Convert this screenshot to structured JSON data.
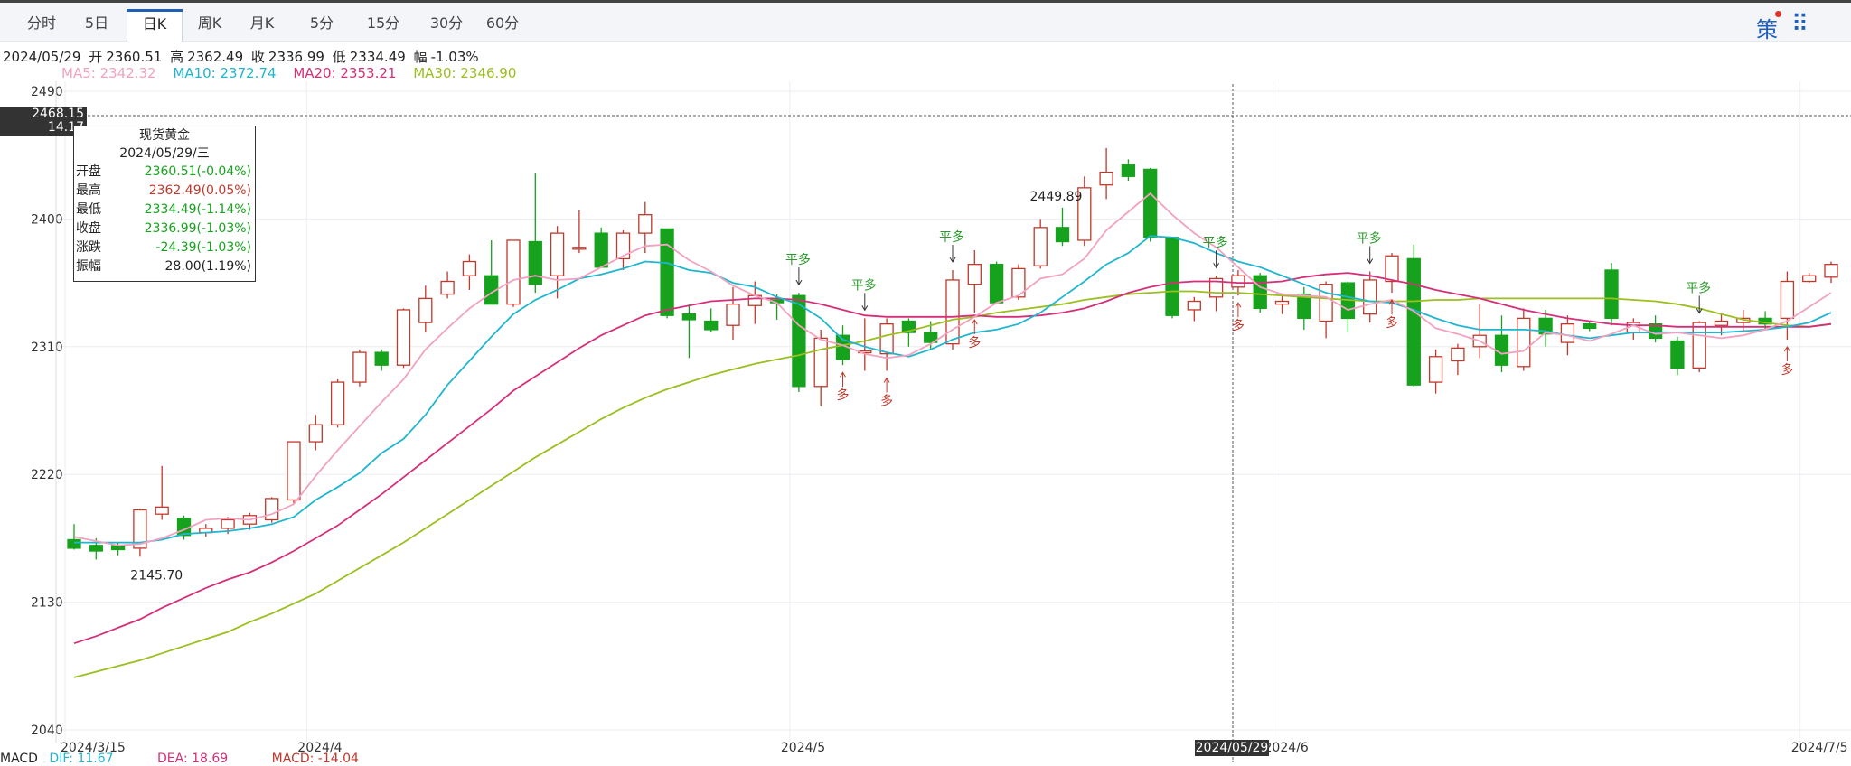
{
  "tabs": [
    {
      "label": "分时",
      "active": false
    },
    {
      "label": "5日",
      "active": false
    },
    {
      "label": "日K",
      "active": true
    },
    {
      "label": "周K",
      "active": false
    },
    {
      "label": "月K",
      "active": false
    },
    {
      "label": "5分",
      "active": false
    },
    {
      "label": "15分",
      "active": false
    },
    {
      "label": "30分",
      "active": false
    },
    {
      "label": "60分",
      "active": false
    }
  ],
  "toolbar": {
    "strategy_icon": "策",
    "layout_icon": "⠿"
  },
  "quote_line": {
    "date": "2024/05/29",
    "open_label": "开",
    "open": "2360.51",
    "high_label": "高",
    "high": "2362.49",
    "close_label": "收",
    "close": "2336.99",
    "low_label": "低",
    "low": "2334.49",
    "range_label": "幅",
    "range": "-1.03%"
  },
  "ma_line": {
    "ma5": "MA5: 2342.32",
    "ma10": "MA10: 2372.74",
    "ma20": "MA20: 2353.21",
    "ma30": "MA30: 2346.90"
  },
  "colors": {
    "up": "#c0392b",
    "down": "#16a21d",
    "ma5": "#f2a2c0",
    "ma10": "#1fb6cf",
    "ma20": "#d62f79",
    "ma30": "#9abf1e",
    "marker_down": "#2a9a2a",
    "marker_up": "#c0392b"
  },
  "tooltip": {
    "title": "现货黄金",
    "date": "2024/05/29/三",
    "rows": [
      {
        "k": "开盘",
        "v": "2360.51(-0.04%)",
        "c": "#16a21d"
      },
      {
        "k": "最高",
        "v": "2362.49(0.05%)",
        "c": "#c0392b"
      },
      {
        "k": "最低",
        "v": "2334.49(-1.14%)",
        "c": "#16a21d"
      },
      {
        "k": "收盘",
        "v": "2336.99(-1.03%)",
        "c": "#16a21d"
      },
      {
        "k": "涨跌",
        "v": "-24.39(-1.03%)",
        "c": "#16a21d"
      },
      {
        "k": "振幅",
        "v": "28.00(1.19%)",
        "c": "#222222"
      }
    ]
  },
  "crosshair": {
    "price": "2468.15",
    "sub": "14.17",
    "date": "2024/05/29"
  },
  "macd_line": {
    "dif": "DIF: 11.67",
    "dea": "DEA: 18.69",
    "macd": "MACD: -14.04",
    "label": "MACD"
  },
  "chart_data": {
    "type": "candlestick",
    "y_ticks": [
      2040,
      2130,
      2220,
      2310,
      2400,
      2490
    ],
    "ylim": [
      2040,
      2490
    ],
    "x_labels": [
      {
        "text": "2024/3/15",
        "index": 0
      },
      {
        "text": "2024/4",
        "index": 11
      },
      {
        "text": "2024/5",
        "index": 33
      },
      {
        "text": "2024/6",
        "index": 55
      },
      {
        "text": "2024/7/5",
        "index": 79
      }
    ],
    "max_label": {
      "text": "2449.89",
      "index": 45
    },
    "min_label": {
      "text": "2145.70",
      "index": 1
    },
    "candles": [
      {
        "o": 2174,
        "h": 2185,
        "l": 2167,
        "c": 2168
      },
      {
        "o": 2170,
        "h": 2175,
        "l": 2160,
        "c": 2166
      },
      {
        "o": 2170,
        "h": 2172,
        "l": 2163,
        "c": 2167
      },
      {
        "o": 2168,
        "h": 2196,
        "l": 2162,
        "c": 2195
      },
      {
        "o": 2192,
        "h": 2226,
        "l": 2188,
        "c": 2197
      },
      {
        "o": 2189,
        "h": 2191,
        "l": 2174,
        "c": 2177
      },
      {
        "o": 2179,
        "h": 2185,
        "l": 2176,
        "c": 2182
      },
      {
        "o": 2182,
        "h": 2190,
        "l": 2178,
        "c": 2188
      },
      {
        "o": 2185,
        "h": 2193,
        "l": 2181,
        "c": 2191
      },
      {
        "o": 2188,
        "h": 2204,
        "l": 2186,
        "c": 2203
      },
      {
        "o": 2202,
        "h": 2243,
        "l": 2199,
        "c": 2243
      },
      {
        "o": 2243,
        "h": 2262,
        "l": 2237,
        "c": 2255
      },
      {
        "o": 2255,
        "h": 2287,
        "l": 2253,
        "c": 2285
      },
      {
        "o": 2285,
        "h": 2308,
        "l": 2282,
        "c": 2306
      },
      {
        "o": 2306,
        "h": 2308,
        "l": 2293,
        "c": 2297
      },
      {
        "o": 2297,
        "h": 2337,
        "l": 2295,
        "c": 2336
      },
      {
        "o": 2327,
        "h": 2353,
        "l": 2320,
        "c": 2344
      },
      {
        "o": 2347,
        "h": 2363,
        "l": 2344,
        "c": 2356
      },
      {
        "o": 2360,
        "h": 2375,
        "l": 2350,
        "c": 2370
      },
      {
        "o": 2360,
        "h": 2385,
        "l": 2342,
        "c": 2340
      },
      {
        "o": 2340,
        "h": 2385,
        "l": 2338,
        "c": 2385
      },
      {
        "o": 2384,
        "h": 2432,
        "l": 2348,
        "c": 2354
      },
      {
        "o": 2360,
        "h": 2395,
        "l": 2344,
        "c": 2390
      },
      {
        "o": 2380,
        "h": 2406,
        "l": 2376,
        "c": 2380
      },
      {
        "o": 2390,
        "h": 2394,
        "l": 2366,
        "c": 2366
      },
      {
        "o": 2372,
        "h": 2392,
        "l": 2364,
        "c": 2390
      },
      {
        "o": 2390,
        "h": 2412,
        "l": 2376,
        "c": 2403
      },
      {
        "o": 2393,
        "h": 2393,
        "l": 2330,
        "c": 2332
      },
      {
        "o": 2333,
        "h": 2340,
        "l": 2302,
        "c": 2329
      },
      {
        "o": 2328,
        "h": 2337,
        "l": 2320,
        "c": 2322
      },
      {
        "o": 2325,
        "h": 2352,
        "l": 2315,
        "c": 2340
      },
      {
        "o": 2339,
        "h": 2356,
        "l": 2326,
        "c": 2346
      },
      {
        "o": 2343,
        "h": 2347,
        "l": 2329,
        "c": 2341
      },
      {
        "o": 2346,
        "h": 2348,
        "l": 2278,
        "c": 2282
      },
      {
        "o": 2282,
        "h": 2322,
        "l": 2268,
        "c": 2316
      },
      {
        "o": 2318,
        "h": 2325,
        "l": 2297,
        "c": 2301
      },
      {
        "o": 2307,
        "h": 2330,
        "l": 2293,
        "c": 2307
      },
      {
        "o": 2305,
        "h": 2330,
        "l": 2293,
        "c": 2326
      },
      {
        "o": 2328,
        "h": 2330,
        "l": 2310,
        "c": 2320
      },
      {
        "o": 2320,
        "h": 2328,
        "l": 2308,
        "c": 2313
      },
      {
        "o": 2312,
        "h": 2364,
        "l": 2308,
        "c": 2357
      },
      {
        "o": 2354,
        "h": 2378,
        "l": 2334,
        "c": 2368
      },
      {
        "o": 2368,
        "h": 2370,
        "l": 2340,
        "c": 2341
      },
      {
        "o": 2345,
        "h": 2368,
        "l": 2343,
        "c": 2365
      },
      {
        "o": 2367,
        "h": 2400,
        "l": 2365,
        "c": 2394
      },
      {
        "o": 2394,
        "h": 2408,
        "l": 2381,
        "c": 2384
      },
      {
        "o": 2385,
        "h": 2430,
        "l": 2381,
        "c": 2422
      },
      {
        "o": 2424,
        "h": 2450,
        "l": 2414,
        "c": 2433
      },
      {
        "o": 2438,
        "h": 2442,
        "l": 2427,
        "c": 2430
      },
      {
        "o": 2435,
        "h": 2436,
        "l": 2384,
        "c": 2387
      },
      {
        "o": 2387,
        "h": 2386,
        "l": 2330,
        "c": 2332
      },
      {
        "o": 2336,
        "h": 2345,
        "l": 2328,
        "c": 2342
      },
      {
        "o": 2345,
        "h": 2360,
        "l": 2335,
        "c": 2358
      },
      {
        "o": 2352,
        "h": 2364,
        "l": 2346,
        "c": 2360
      },
      {
        "o": 2360,
        "h": 2362,
        "l": 2334,
        "c": 2337
      },
      {
        "o": 2340,
        "h": 2346,
        "l": 2333,
        "c": 2342
      },
      {
        "o": 2347,
        "h": 2352,
        "l": 2322,
        "c": 2330
      },
      {
        "o": 2328,
        "h": 2356,
        "l": 2316,
        "c": 2354
      },
      {
        "o": 2355,
        "h": 2356,
        "l": 2320,
        "c": 2330
      },
      {
        "o": 2333,
        "h": 2363,
        "l": 2327,
        "c": 2357
      },
      {
        "o": 2356,
        "h": 2376,
        "l": 2348,
        "c": 2374
      },
      {
        "o": 2372,
        "h": 2382,
        "l": 2282,
        "c": 2283
      },
      {
        "o": 2285,
        "h": 2308,
        "l": 2277,
        "c": 2303
      },
      {
        "o": 2300,
        "h": 2312,
        "l": 2290,
        "c": 2309
      },
      {
        "o": 2310,
        "h": 2340,
        "l": 2302,
        "c": 2318
      },
      {
        "o": 2318,
        "h": 2332,
        "l": 2292,
        "c": 2297
      },
      {
        "o": 2296,
        "h": 2337,
        "l": 2293,
        "c": 2330
      },
      {
        "o": 2330,
        "h": 2336,
        "l": 2310,
        "c": 2319
      },
      {
        "o": 2313,
        "h": 2332,
        "l": 2304,
        "c": 2326
      },
      {
        "o": 2326,
        "h": 2327,
        "l": 2321,
        "c": 2323
      },
      {
        "o": 2364,
        "h": 2369,
        "l": 2325,
        "c": 2330
      },
      {
        "o": 2320,
        "h": 2330,
        "l": 2315,
        "c": 2327
      },
      {
        "o": 2326,
        "h": 2332,
        "l": 2313,
        "c": 2316
      },
      {
        "o": 2314,
        "h": 2317,
        "l": 2290,
        "c": 2295
      },
      {
        "o": 2295,
        "h": 2328,
        "l": 2292,
        "c": 2327
      },
      {
        "o": 2325,
        "h": 2333,
        "l": 2318,
        "c": 2328
      },
      {
        "o": 2327,
        "h": 2336,
        "l": 2320,
        "c": 2330
      },
      {
        "o": 2330,
        "h": 2335,
        "l": 2322,
        "c": 2326
      },
      {
        "o": 2330,
        "h": 2363,
        "l": 2315,
        "c": 2356
      },
      {
        "o": 2356,
        "h": 2362,
        "l": 2355,
        "c": 2360
      },
      {
        "o": 2359,
        "h": 2370,
        "l": 2355,
        "c": 2368
      }
    ],
    "ma5": [
      2176,
      2173,
      2170,
      2171,
      2175,
      2181,
      2188,
      2189,
      2188,
      2192,
      2199,
      2219,
      2237,
      2254,
      2271,
      2287,
      2308,
      2323,
      2337,
      2348,
      2357,
      2360,
      2357,
      2358,
      2366,
      2374,
      2381,
      2382,
      2371,
      2363,
      2353,
      2346,
      2341,
      2325,
      2315,
      2311,
      2305,
      2302,
      2304,
      2312,
      2322,
      2331,
      2341,
      2346,
      2358,
      2361,
      2372,
      2392,
      2405,
      2418,
      2403,
      2390,
      2380,
      2366,
      2352,
      2347,
      2346,
      2345,
      2336,
      2340,
      2343,
      2335,
      2323,
      2319,
      2314,
      2305,
      2307,
      2320,
      2318,
      2314,
      2319,
      2325,
      2319,
      2320,
      2318,
      2316,
      2318,
      2322,
      2328,
      2338,
      2348
    ],
    "ma10": [
      2172,
      2172,
      2172,
      2172,
      2174,
      2178,
      2179,
      2180,
      2182,
      2185,
      2190,
      2202,
      2211,
      2221,
      2235,
      2245,
      2262,
      2283,
      2300,
      2317,
      2333,
      2343,
      2350,
      2358,
      2361,
      2365,
      2370,
      2369,
      2364,
      2362,
      2355,
      2352,
      2345,
      2340,
      2330,
      2315,
      2310,
      2306,
      2303,
      2308,
      2315,
      2320,
      2322,
      2326,
      2334,
      2345,
      2356,
      2368,
      2376,
      2388,
      2387,
      2383,
      2376,
      2370,
      2366,
      2360,
      2354,
      2348,
      2345,
      2342,
      2341,
      2336,
      2330,
      2325,
      2322,
      2322,
      2322,
      2321,
      2318,
      2316,
      2318,
      2320,
      2320,
      2320,
      2320,
      2320,
      2321,
      2322,
      2324,
      2327,
      2334
    ],
    "ma20": [
      2101,
      2106,
      2112,
      2118,
      2126,
      2133,
      2140,
      2146,
      2151,
      2158,
      2166,
      2175,
      2184,
      2195,
      2206,
      2218,
      2230,
      2242,
      2254,
      2266,
      2279,
      2289,
      2299,
      2309,
      2318,
      2325,
      2332,
      2336,
      2339,
      2342,
      2343,
      2344,
      2344,
      2343,
      2340,
      2336,
      2332,
      2331,
      2331,
      2331,
      2331,
      2332,
      2331,
      2331,
      2332,
      2334,
      2337,
      2342,
      2348,
      2352,
      2355,
      2356,
      2356,
      2355,
      2355,
      2356,
      2359,
      2361,
      2362,
      2360,
      2357,
      2354,
      2350,
      2347,
      2344,
      2340,
      2336,
      2333,
      2330,
      2328,
      2326,
      2325,
      2325,
      2324,
      2324,
      2324,
      2324,
      2324,
      2324,
      2324,
      2326
    ],
    "ma30": [
      2077,
      2081,
      2085,
      2089,
      2094,
      2099,
      2104,
      2109,
      2116,
      2122,
      2129,
      2136,
      2145,
      2154,
      2163,
      2172,
      2182,
      2192,
      2202,
      2212,
      2222,
      2232,
      2241,
      2250,
      2259,
      2267,
      2274,
      2280,
      2285,
      2290,
      2294,
      2298,
      2301,
      2304,
      2308,
      2311,
      2314,
      2318,
      2321,
      2325,
      2329,
      2331,
      2334,
      2336,
      2338,
      2340,
      2343,
      2345,
      2347,
      2348,
      2349,
      2349,
      2348,
      2348,
      2347,
      2346,
      2345,
      2344,
      2343,
      2342,
      2342,
      2342,
      2343,
      2343,
      2344,
      2344,
      2344,
      2344,
      2344,
      2344,
      2344,
      2343,
      2342,
      2340,
      2337,
      2333,
      2329,
      2327,
      2325,
      2324,
      2326
    ],
    "signals": [
      {
        "index": 33,
        "kind": "平多",
        "pos": "above"
      },
      {
        "index": 35,
        "kind": "多",
        "pos": "below"
      },
      {
        "index": 36,
        "kind": "平多",
        "pos": "above"
      },
      {
        "index": 37,
        "kind": "多",
        "pos": "below"
      },
      {
        "index": 40,
        "kind": "平多",
        "pos": "above"
      },
      {
        "index": 41,
        "kind": "多",
        "pos": "below"
      },
      {
        "index": 52,
        "kind": "平多",
        "pos": "above"
      },
      {
        "index": 53,
        "kind": "多",
        "pos": "below"
      },
      {
        "index": 59,
        "kind": "平多",
        "pos": "above"
      },
      {
        "index": 60,
        "kind": "多",
        "pos": "below"
      },
      {
        "index": 74,
        "kind": "平多",
        "pos": "above"
      },
      {
        "index": 78,
        "kind": "多",
        "pos": "below"
      }
    ]
  }
}
